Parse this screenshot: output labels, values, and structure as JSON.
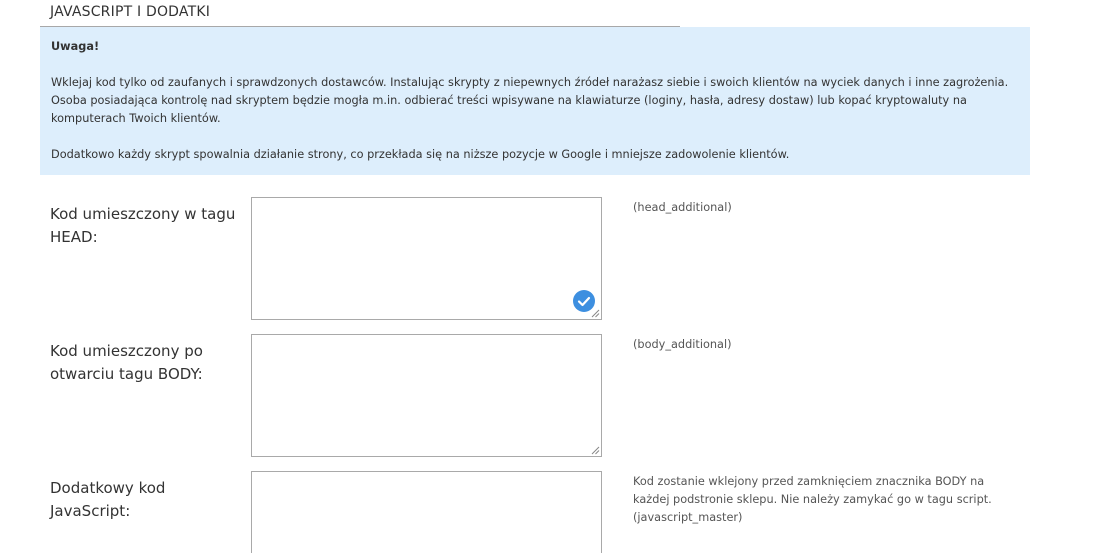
{
  "section": {
    "title": "JAVASCRIPT I DODATKI"
  },
  "notice": {
    "heading": "Uwaga!",
    "paragraph1": "Wklejaj kod tylko od zaufanych i sprawdzonych dostawców. Instalując skrypty z niepewnych źródeł narażasz siebie i swoich klientów na wyciek danych i inne zagrożenia. Osoba posiadająca kontrolę nad skryptem będzie mogła m.in. odbierać treści wpisywane na klawiaturze (loginy, hasła, adresy dostaw) lub kopać kryptowaluty na komputerach Twoich klientów.",
    "paragraph2": "Dodatkowo każdy skrypt spowalnia działanie strony, co przekłada się na niższe pozycje w Google i mniejsze zadowolenie klientów.",
    "background": "#ddeefc"
  },
  "fields": [
    {
      "label": "Kod umieszczony w tagu HEAD:",
      "value": "",
      "hint": "(head_additional)",
      "validated": true,
      "icon": "check-circle-icon"
    },
    {
      "label": "Kod umieszczony po otwarciu tagu BODY:",
      "value": "",
      "hint": "(body_additional)",
      "validated": false
    },
    {
      "label": "Dodatkowy kod JavaScript:",
      "value": "",
      "hint": "Kod zostanie wklejony przed zamknięciem znacznika BODY na każdej podstronie sklepu. Nie należy zamykać go w tagu script. (javascript_master)",
      "validated": false
    }
  ],
  "colors": {
    "check_icon": "#3d8fe0",
    "border": "#a9a9a9"
  }
}
